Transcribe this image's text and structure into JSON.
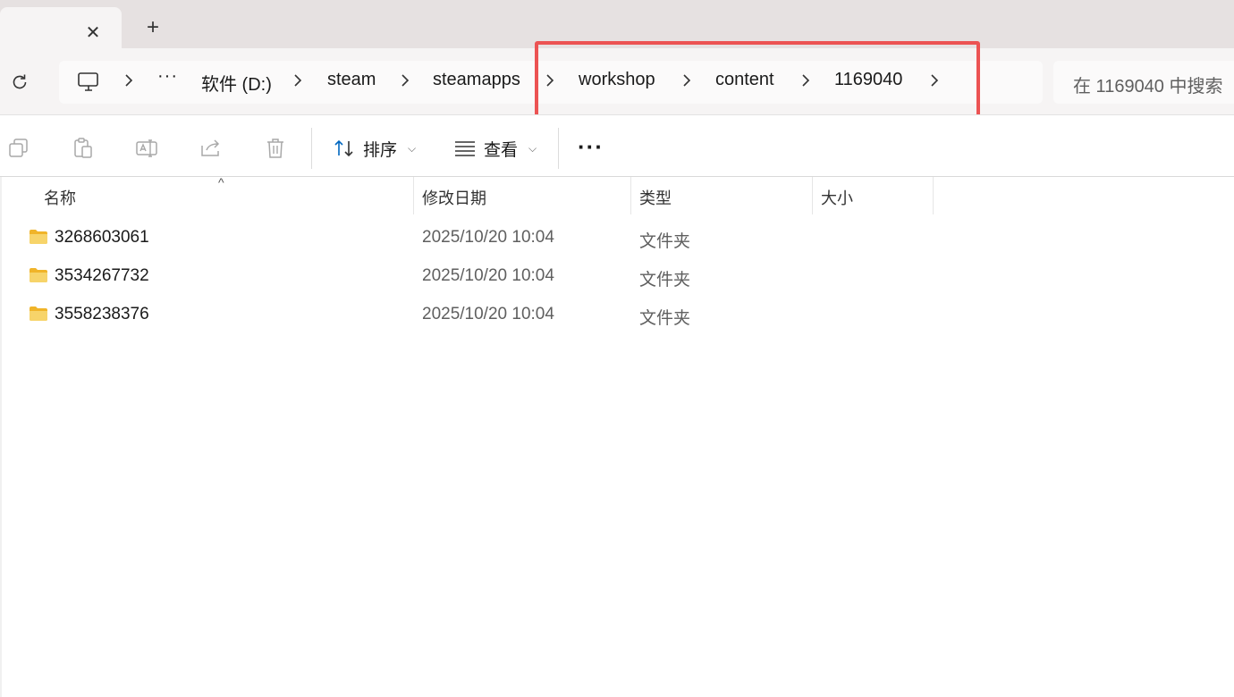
{
  "tabbar": {
    "close_glyph": "✕",
    "new_tab_glyph": "+"
  },
  "address": {
    "crumbs": [
      "软件 (D:)",
      "steam",
      "steamapps",
      "workshop",
      "content",
      "1169040"
    ],
    "overflow": "···",
    "search_placeholder": "在 1169040 中搜索"
  },
  "toolbar": {
    "sort_label": "排序",
    "view_label": "查看",
    "more": "···",
    "icons": [
      "copy-icon",
      "paste-icon",
      "rename-icon",
      "share-icon",
      "delete-icon"
    ]
  },
  "columns": {
    "name": "名称",
    "modified": "修改日期",
    "type": "类型",
    "size": "大小"
  },
  "files": [
    {
      "name": "3268603061",
      "modified": "2025/10/20 10:04",
      "type": "文件夹",
      "size": ""
    },
    {
      "name": "3534267732",
      "modified": "2025/10/20 10:04",
      "type": "文件夹",
      "size": ""
    },
    {
      "name": "3558238376",
      "modified": "2025/10/20 10:04",
      "type": "文件夹",
      "size": ""
    }
  ],
  "colors": {
    "highlight": "#ec5353",
    "folder": "#f7c948",
    "accent": "#0067c0"
  }
}
